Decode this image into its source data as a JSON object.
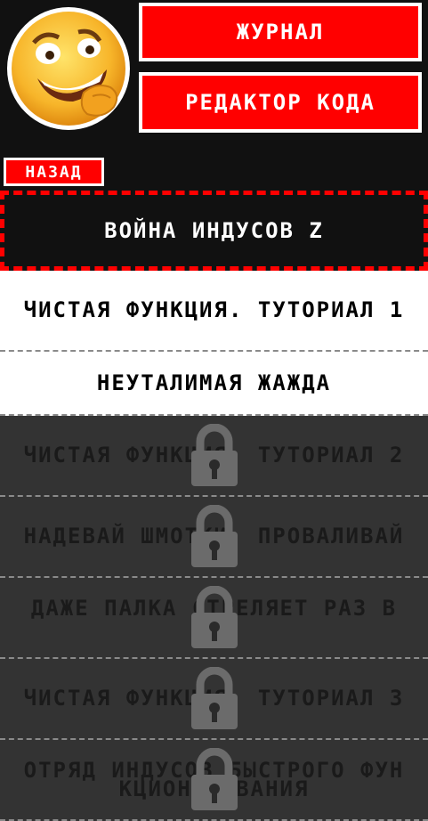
{
  "header": {
    "journal_label": "ЖУРНАЛ",
    "editor_label": "РЕДАКТОР КОДА",
    "avatar_icon": "smirking-emoji-icon"
  },
  "back_label": "НАЗАД",
  "levels": [
    {
      "title": "ВОЙНА ИНДУСОВ Z",
      "state": "active"
    },
    {
      "title": "ЧИСТАЯ ФУНКЦИЯ. ТУТОРИАЛ 1",
      "state": "open"
    },
    {
      "title": "НЕУТАЛИМАЯ ЖАЖДА",
      "state": "open"
    },
    {
      "title": "ЧИСТАЯ ФУНКЦИЯ. ТУТОРИАЛ 2",
      "state": "locked"
    },
    {
      "title": "НАДЕВАЙ ШМОТКИ, ПРОВАЛИВАЙ",
      "state": "locked"
    },
    {
      "title": "ДАЖЕ ПАЛКА СТРЕЛЯЕТ РАЗ В ГОД",
      "state": "locked"
    },
    {
      "title": "ЧИСТАЯ ФУНКЦИЯ. ТУТОРИАЛ 3",
      "state": "locked"
    },
    {
      "title": "ОТРЯД ИНДУСОВ БЫСТРОГО ФУНКЦИОНИРОВАНИЯ",
      "state": "locked"
    }
  ],
  "colors": {
    "accent": "#ff0000",
    "background": "#111111",
    "locked_row": "#333333",
    "open_row": "#ffffff",
    "lock_icon": "#6b6b6b"
  }
}
